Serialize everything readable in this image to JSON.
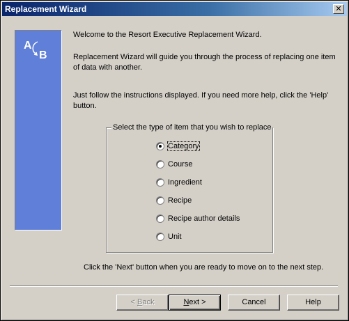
{
  "window": {
    "title": "Replacement Wizard",
    "close_glyph": "✕"
  },
  "side_panel": {
    "icon": "ab-replace-icon",
    "from_letter": "A",
    "to_letter": "B",
    "color": "#5f7fd8"
  },
  "intro": {
    "welcome": "Welcome to the Resort Executive Replacement Wizard.",
    "guide_line1": "Replacement Wizard will guide you through the process of replacing one item",
    "guide_line2": "of data with another.",
    "help_line1": "Just follow the instructions displayed.  If you need more help, click the 'Help'",
    "help_line2": "button."
  },
  "item_group": {
    "legend": "Select the type of item that you wish to replace",
    "options": [
      {
        "label": "Category",
        "checked": true
      },
      {
        "label": "Course",
        "checked": false
      },
      {
        "label": "Ingredient",
        "checked": false
      },
      {
        "label": "Recipe",
        "checked": false
      },
      {
        "label": "Recipe author details",
        "checked": false
      },
      {
        "label": "Unit",
        "checked": false
      }
    ]
  },
  "footer_instruction": "Click the 'Next' button when you are ready to move on to the next step.",
  "buttons": {
    "back_prefix": "< ",
    "back_accel": "B",
    "back_rest": "ack",
    "back_enabled": false,
    "next_accel": "N",
    "next_rest": "ext >",
    "cancel": "Cancel",
    "help": "Help"
  }
}
